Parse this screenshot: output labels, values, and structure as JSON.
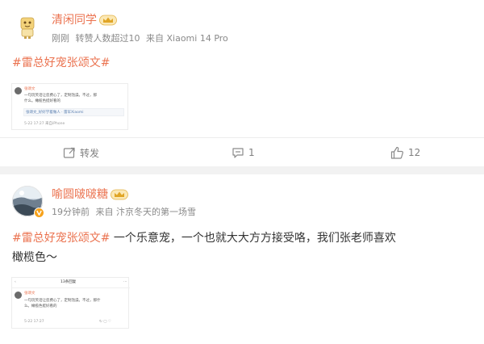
{
  "post1": {
    "username": "清闲同学",
    "time": "刚刚",
    "repost_note": "转赞人数超过10",
    "source": "来自 Xiaomi 14 Pro",
    "topic": "#雷总好宠张颂文#",
    "embedded": {
      "username": "张颂文",
      "line1": "一句玩笑话让您费心了，定制泡澡。不过，那",
      "line2": "什么。橄榄色挺好看的",
      "link": "张颂文_好好学着做人 · 雷军Xiaomi",
      "time": "5-22 17:27 来自iPhone"
    },
    "actions": {
      "repost_label": "转发",
      "comment_count": "1",
      "like_count": "12"
    }
  },
  "post2": {
    "username": "喻圆啵啵糖",
    "time": "19分钟前",
    "source": "来自 汴京冬天的第一场雪",
    "topic": "#雷总好宠张颂文#",
    "text_line1": " 一个乐意宠，一个也就大大方方接受咯，我们张老师喜欢",
    "text_line2": "橄榄色～",
    "embedded": {
      "header": "13条回复",
      "username": "张颂文",
      "line1": "一句玩笑话让您费心了，定制泡澡。不过，那什",
      "line2": "么。橄榄色挺好看的",
      "time": "5-22 17:27"
    }
  },
  "colors": {
    "username": "#eb7350",
    "topic": "#eb7350",
    "meta": "#8a8a8a",
    "background": "#f2f2f2"
  },
  "icons": [
    "mascot-avatar-icon",
    "vip-crown-icon",
    "repost-icon",
    "comment-icon",
    "like-icon",
    "verified-v-icon"
  ]
}
